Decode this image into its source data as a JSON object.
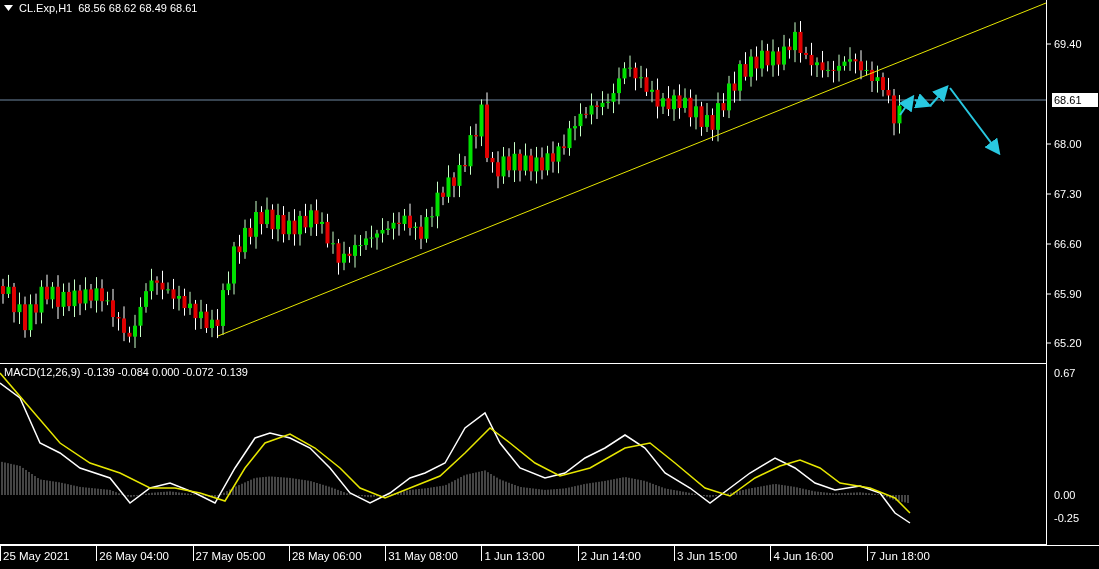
{
  "header": {
    "symbol": "CL.Exp,H1",
    "ohlc": "68.56 68.62 68.49 68.61"
  },
  "price_axis": [
    "69.40",
    "68.00",
    "67.30",
    "66.60",
    "65.90",
    "65.20"
  ],
  "current_price": "68.61",
  "macd": {
    "label": "MACD(12,26,9) -0.139 -0.084 0.000 -0.072 -0.139",
    "axis": [
      "0.67",
      "0.00",
      "-0.25"
    ]
  },
  "time_axis": [
    "25 May 2021",
    "26 May 04:00",
    "27 May 05:00",
    "28 May 06:00",
    "31 May 08:00",
    "1 Jun 13:00",
    "2 Jun 14:00",
    "3 Jun 15:00",
    "4 Jun 16:00",
    "7 Jun 18:00"
  ]
}
